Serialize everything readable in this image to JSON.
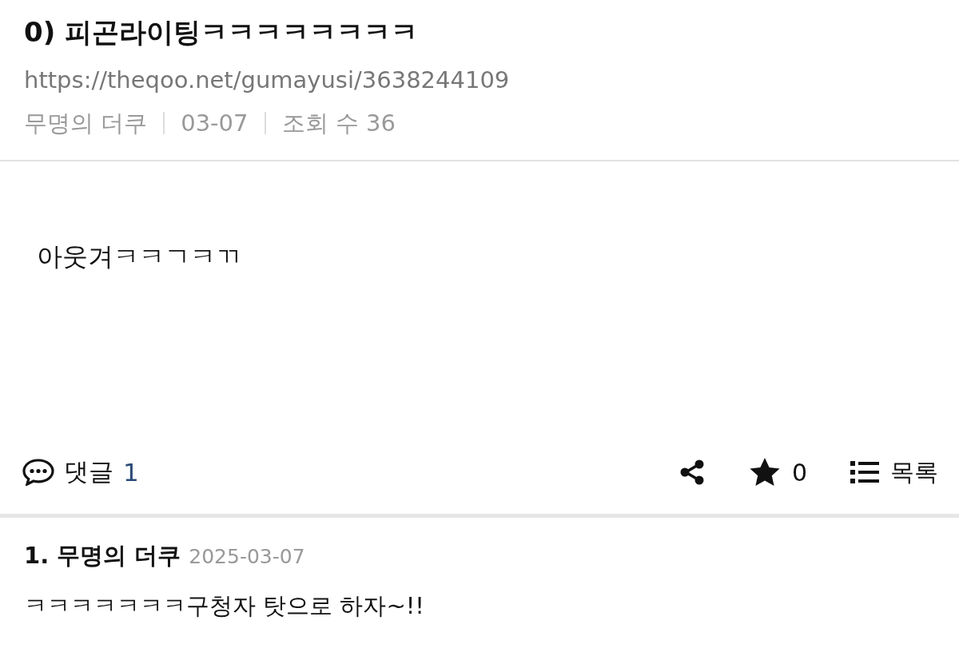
{
  "post": {
    "title": "0) 피곤라이팅ㅋㅋㅋㅋㅋㅋㅋㅋ",
    "url": "https://theqoo.net/gumayusi/3638244109",
    "meta": [
      "무명의 더쿠",
      "03-07",
      "조회 수 36"
    ],
    "body": "아웃겨ㅋㅋㄱㅋㄲ"
  },
  "actions": {
    "comments_label": "댓글",
    "comments_count": "1",
    "votes": "0",
    "list_label": "목록"
  },
  "comments": [
    {
      "number": "1.",
      "author": "무명의 더쿠",
      "date": "2025-03-07",
      "text": "ㅋㅋㅋㅋㅋㅋㅋ구청자 탓으로 하자~!!"
    }
  ]
}
